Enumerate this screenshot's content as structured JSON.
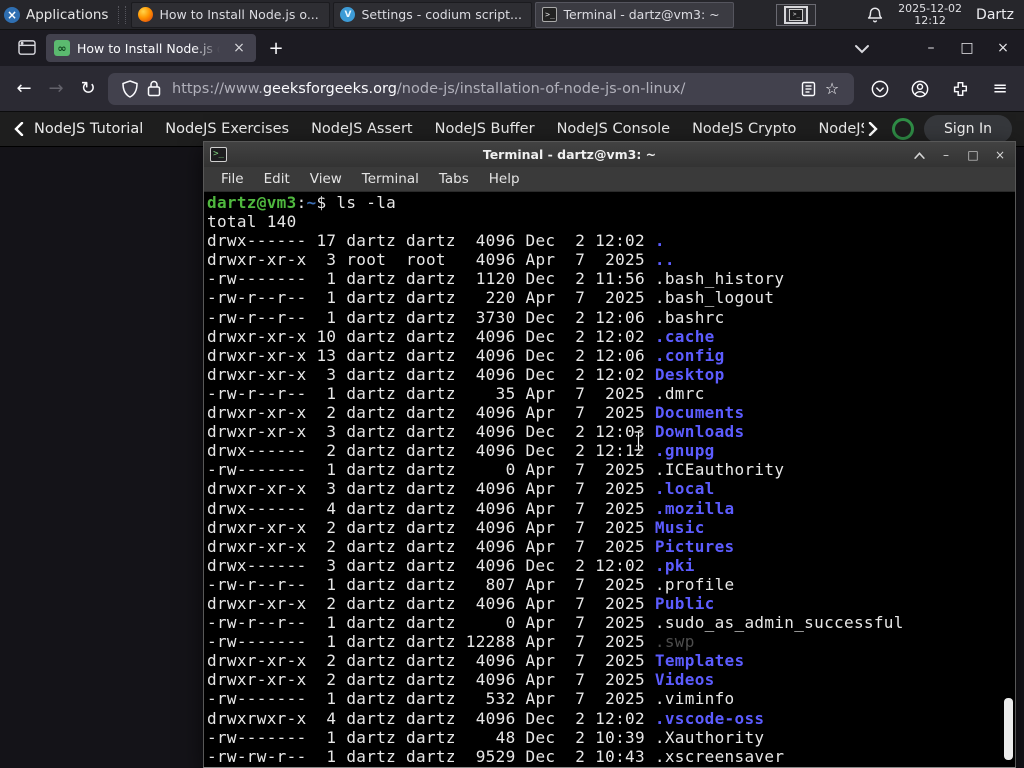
{
  "panel": {
    "applications_label": "Applications",
    "windows": [
      {
        "label": "How to Install Node.js o...",
        "icon": "firefox"
      },
      {
        "label": "Settings - codium script...",
        "icon": "codium"
      },
      {
        "label": "Terminal - dartz@vm3: ~",
        "icon": "terminal",
        "active": true
      }
    ],
    "clock_date": "2025-12-02",
    "clock_time": "12:12",
    "user_label": "Dartz"
  },
  "browser": {
    "tab_title": "How to Install Node.js on",
    "new_tab_label": "+",
    "close_glyph": "×",
    "url": {
      "prefix": "https://www.",
      "domain": "geeksforgeeks.org",
      "path": "/node-js/installation-of-node-js-on-linux/"
    }
  },
  "site_nav": {
    "items": [
      "NodeJS Tutorial",
      "NodeJS Exercises",
      "NodeJS Assert",
      "NodeJS Buffer",
      "NodeJS Console",
      "NodeJS Crypto",
      "NodeJS DNS",
      "Node"
    ],
    "sign_in_label": "Sign In"
  },
  "terminal": {
    "title": "Terminal - dartz@vm3: ~",
    "menu": [
      "File",
      "Edit",
      "View",
      "Terminal",
      "Tabs",
      "Help"
    ],
    "prompt": {
      "user_host": "dartz@vm3",
      "colon": ":",
      "cwd": "~",
      "rest": "$ ls -la"
    },
    "total_line": "total 140",
    "listing": [
      {
        "pre": "drwx------ 17 dartz dartz  4096 Dec  2 12:02 ",
        "name": ".",
        "type": "dir"
      },
      {
        "pre": "drwxr-xr-x  3 root  root   4096 Apr  7  2025 ",
        "name": "..",
        "type": "dir"
      },
      {
        "pre": "-rw-------  1 dartz dartz  1120 Dec  2 11:56 ",
        "name": ".bash_history",
        "type": "file"
      },
      {
        "pre": "-rw-r--r--  1 dartz dartz   220 Apr  7  2025 ",
        "name": ".bash_logout",
        "type": "file"
      },
      {
        "pre": "-rw-r--r--  1 dartz dartz  3730 Dec  2 12:06 ",
        "name": ".bashrc",
        "type": "file"
      },
      {
        "pre": "drwxr-xr-x 10 dartz dartz  4096 Dec  2 12:02 ",
        "name": ".cache",
        "type": "dir"
      },
      {
        "pre": "drwxr-xr-x 13 dartz dartz  4096 Dec  2 12:06 ",
        "name": ".config",
        "type": "dir"
      },
      {
        "pre": "drwxr-xr-x  3 dartz dartz  4096 Dec  2 12:02 ",
        "name": "Desktop",
        "type": "dir"
      },
      {
        "pre": "-rw-r--r--  1 dartz dartz    35 Apr  7  2025 ",
        "name": ".dmrc",
        "type": "file"
      },
      {
        "pre": "drwxr-xr-x  2 dartz dartz  4096 Apr  7  2025 ",
        "name": "Documents",
        "type": "dir"
      },
      {
        "pre": "drwxr-xr-x  3 dartz dartz  4096 Dec  2 12:03 ",
        "name": "Downloads",
        "type": "dir"
      },
      {
        "pre": "drwx------  2 dartz dartz  4096 Dec  2 12:12 ",
        "name": ".gnupg",
        "type": "dir"
      },
      {
        "pre": "-rw-------  1 dartz dartz     0 Apr  7  2025 ",
        "name": ".ICEauthority",
        "type": "file"
      },
      {
        "pre": "drwxr-xr-x  3 dartz dartz  4096 Apr  7  2025 ",
        "name": ".local",
        "type": "dir"
      },
      {
        "pre": "drwx------  4 dartz dartz  4096 Apr  7  2025 ",
        "name": ".mozilla",
        "type": "dir"
      },
      {
        "pre": "drwxr-xr-x  2 dartz dartz  4096 Apr  7  2025 ",
        "name": "Music",
        "type": "dir"
      },
      {
        "pre": "drwxr-xr-x  2 dartz dartz  4096 Apr  7  2025 ",
        "name": "Pictures",
        "type": "dir"
      },
      {
        "pre": "drwx------  3 dartz dartz  4096 Dec  2 12:02 ",
        "name": ".pki",
        "type": "dir"
      },
      {
        "pre": "-rw-r--r--  1 dartz dartz   807 Apr  7  2025 ",
        "name": ".profile",
        "type": "file"
      },
      {
        "pre": "drwxr-xr-x  2 dartz dartz  4096 Apr  7  2025 ",
        "name": "Public",
        "type": "dir"
      },
      {
        "pre": "-rw-r--r--  1 dartz dartz     0 Apr  7  2025 ",
        "name": ".sudo_as_admin_successful",
        "type": "file"
      },
      {
        "pre": "-rw-------  1 dartz dartz 12288 Apr  7  2025 ",
        "name": ".swp",
        "type": "dim"
      },
      {
        "pre": "drwxr-xr-x  2 dartz dartz  4096 Apr  7  2025 ",
        "name": "Templates",
        "type": "dir"
      },
      {
        "pre": "drwxr-xr-x  2 dartz dartz  4096 Apr  7  2025 ",
        "name": "Videos",
        "type": "dir"
      },
      {
        "pre": "-rw-------  1 dartz dartz   532 Apr  7  2025 ",
        "name": ".viminfo",
        "type": "file"
      },
      {
        "pre": "drwxrwxr-x  4 dartz dartz  4096 Dec  2 12:02 ",
        "name": ".vscode-oss",
        "type": "dir"
      },
      {
        "pre": "-rw-------  1 dartz dartz    48 Dec  2 10:39 ",
        "name": ".Xauthority",
        "type": "file"
      },
      {
        "pre": "-rw-rw-r--  1 dartz dartz  9529 Dec  2 10:43 ",
        "name": ".xscreensaver",
        "type": "file"
      }
    ]
  },
  "icons": {
    "applications": "xubuntu-logo",
    "firefox_window": "firefox",
    "codium_window": "codium-circle",
    "terminal_window": "terminal",
    "notification": "bell",
    "search": "green-magnifier-ring"
  },
  "colors": {
    "gfg_green": "#2f8d46",
    "dir_blue": "#5c5cff",
    "prompt_green": "#4fb83e",
    "cwd_blue": "#3c6eb4",
    "panel_bg": "#26262b",
    "terminal_bg": "#000000"
  }
}
